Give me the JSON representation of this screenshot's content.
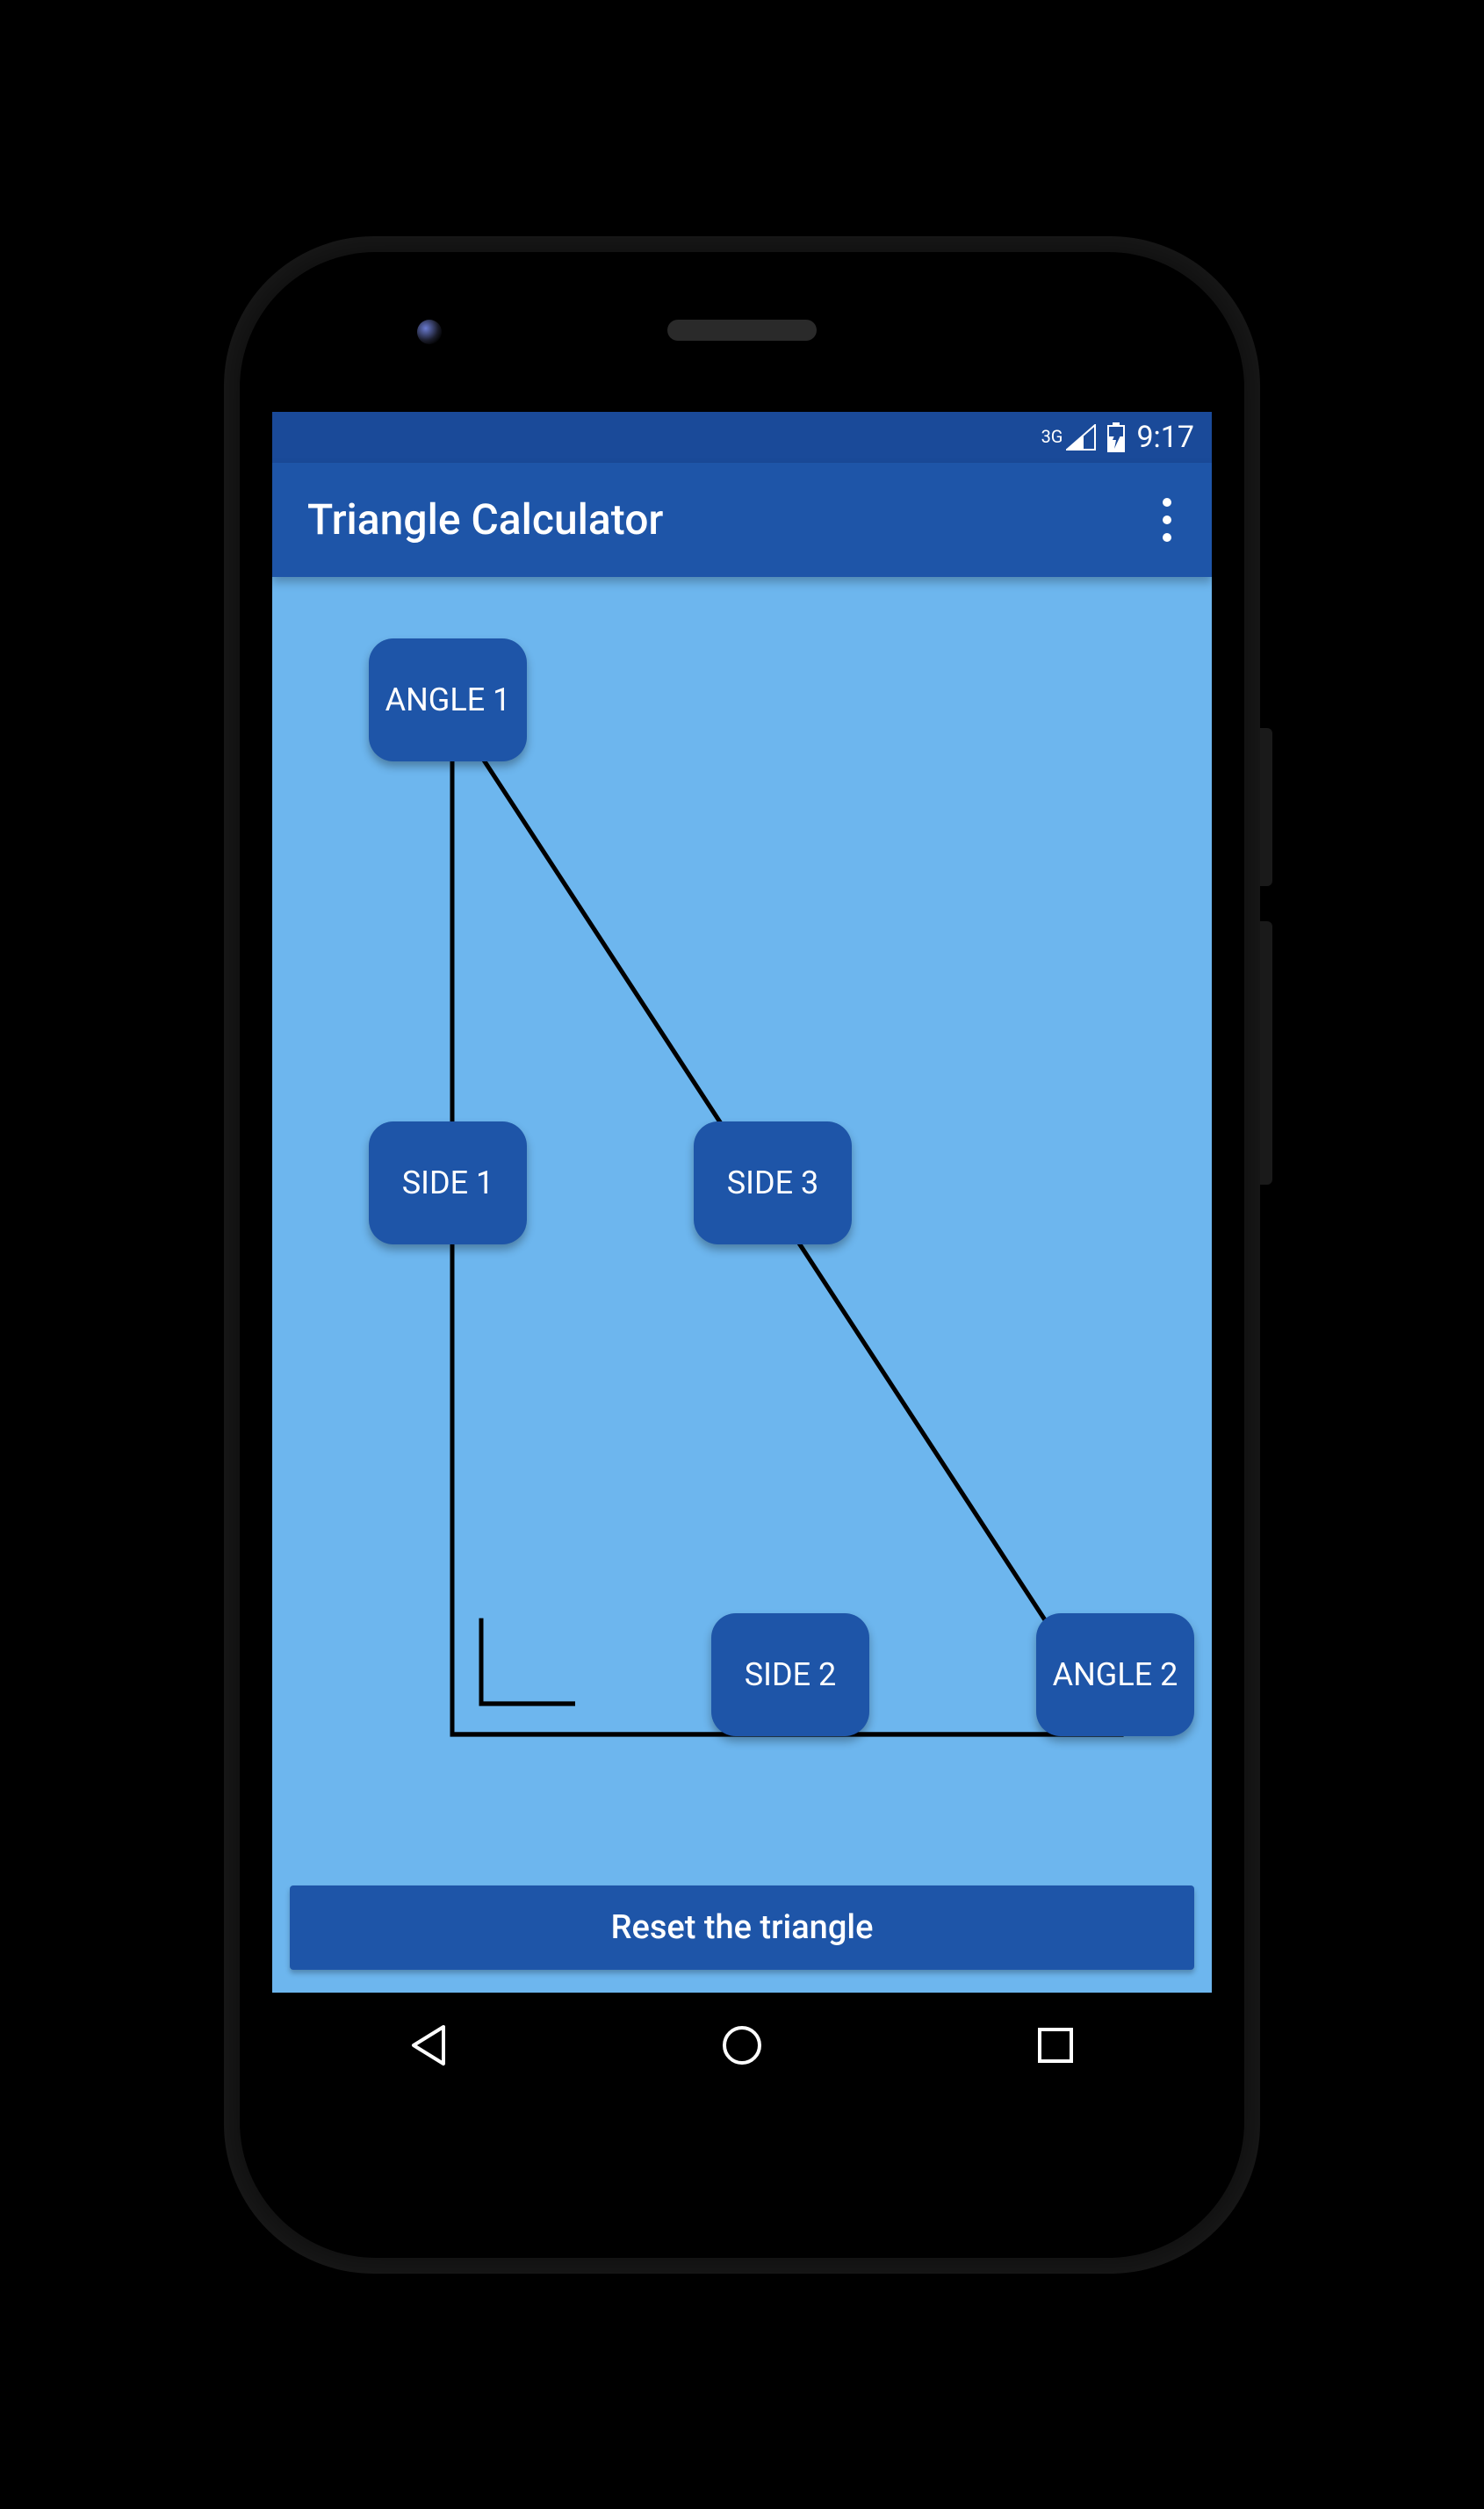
{
  "status": {
    "network_label": "3G",
    "time": "9:17"
  },
  "appbar": {
    "title": "Triangle Calculator"
  },
  "triangle": {
    "angle1": "ANGLE 1",
    "angle2": "ANGLE 2",
    "side1": "SIDE 1",
    "side2": "SIDE 2",
    "side3": "SIDE 3"
  },
  "buttons": {
    "reset": "Reset the triangle"
  },
  "colors": {
    "primary": "#1E55A8",
    "primary_dark": "#1A4A99",
    "content_bg": "#6DB6EE"
  }
}
